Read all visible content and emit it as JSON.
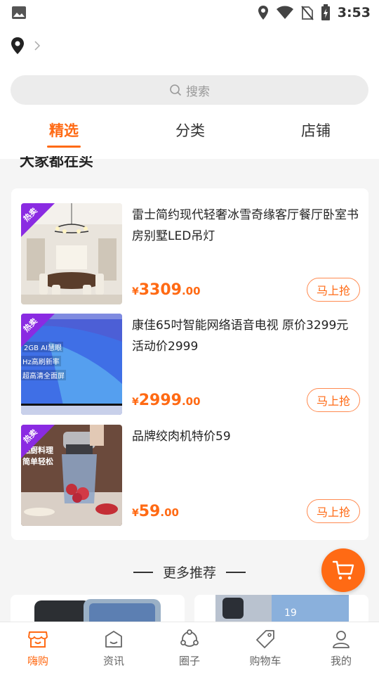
{
  "status_bar": {
    "time": "3:53"
  },
  "search": {
    "placeholder": "搜索"
  },
  "tabs": [
    {
      "label": "精选",
      "active": true
    },
    {
      "label": "分类",
      "active": false
    },
    {
      "label": "店铺",
      "active": false
    }
  ],
  "section": {
    "title": "大家都在买"
  },
  "products": [
    {
      "badge": "热卖",
      "title": "雷士简约现代轻奢冰雪奇缘客厅餐厅卧室书房别墅LED吊灯",
      "price_symbol": "¥",
      "price_int": "3309",
      "price_dec": ".00",
      "buy_label": "马上抢"
    },
    {
      "badge": "热卖",
      "title": "康佳65吋智能网络语音电视 原价3299元 活动价2999",
      "price_symbol": "¥",
      "price_int": "2999",
      "price_dec": ".00",
      "buy_label": "马上抢",
      "image_text": [
        "2GB AI慧眼",
        "Hz高刷新率",
        "超高清全面屏"
      ]
    },
    {
      "badge": "热卖",
      "title": "品牌绞肉机特价59",
      "price_symbol": "¥",
      "price_int": "59",
      "price_dec": ".00",
      "buy_label": "马上抢",
      "image_text": [
        "品厨料理",
        "简单轻松"
      ]
    }
  ],
  "more": {
    "label": "更多推荐"
  },
  "rec_image_text": "19",
  "bottom_nav": [
    {
      "label": "嗨购",
      "icon": "shop-icon",
      "active": true
    },
    {
      "label": "资讯",
      "icon": "news-icon",
      "active": false
    },
    {
      "label": "圈子",
      "icon": "circle-icon",
      "active": false
    },
    {
      "label": "购物车",
      "icon": "tag-icon",
      "active": false
    },
    {
      "label": "我的",
      "icon": "profile-icon",
      "active": false
    }
  ],
  "colors": {
    "accent": "#ff6a14",
    "badge": "#8a2be2",
    "background": "#f5f5f5"
  }
}
